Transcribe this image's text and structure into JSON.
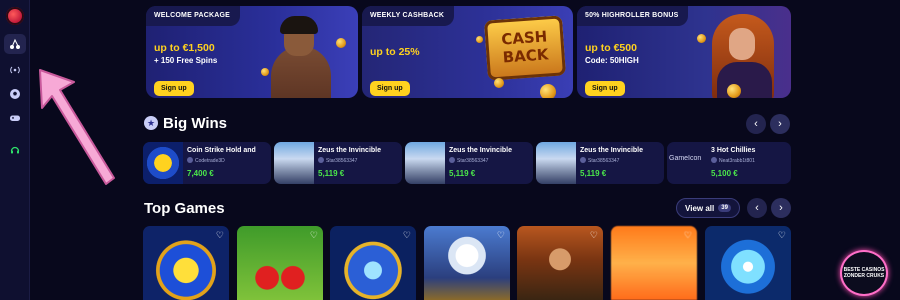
{
  "sidebar": {
    "items": [
      {
        "icon": "cherries-icon"
      },
      {
        "icon": "live-signal-icon"
      },
      {
        "icon": "soccer-ball-icon"
      },
      {
        "icon": "gamepad-icon"
      },
      {
        "icon": "support-headset-icon"
      }
    ]
  },
  "promos": [
    {
      "label": "WELCOME PACKAGE",
      "amount": "up to €1,500",
      "sub": "+ 150 Free Spins",
      "button": "Sign up"
    },
    {
      "label": "WEEKLY CASHBACK",
      "amount": "up to 25%",
      "sub": "",
      "button": "Sign up",
      "art_text_1": "CASH",
      "art_text_2": "BACK"
    },
    {
      "label": "50% HIGHROLLER BONUS",
      "amount": "up to €500",
      "sub": "Code: 50HIGH",
      "button": "Sign up"
    }
  ],
  "big_wins": {
    "title": "Big Wins",
    "items": [
      {
        "game": "Coin Strike Hold and",
        "user": "Codetrade3D",
        "amount": "7,400 €"
      },
      {
        "game": "Zeus the Invincible",
        "user": "Star38563347",
        "amount": "5,119 €"
      },
      {
        "game": "Zeus the Invincible",
        "user": "Star38563347",
        "amount": "5,119 €"
      },
      {
        "game": "Zeus the Invincible",
        "user": "Star38563347",
        "amount": "5,119 €"
      },
      {
        "game": "3 Hot Chillies",
        "user": "Neat3rabb1t801",
        "amount": "5,100 €",
        "image_alt": "GameIcon"
      }
    ]
  },
  "top_games": {
    "title": "Top Games",
    "view_all": "View all",
    "count": "39"
  },
  "badge": {
    "line1": "BESTE CASINOS",
    "line2": "ZONDER CRUKS"
  },
  "colors": {
    "accent_yellow": "#ffd21f",
    "win_green": "#4be84b",
    "annotation_pink": "#f7a9d6"
  }
}
